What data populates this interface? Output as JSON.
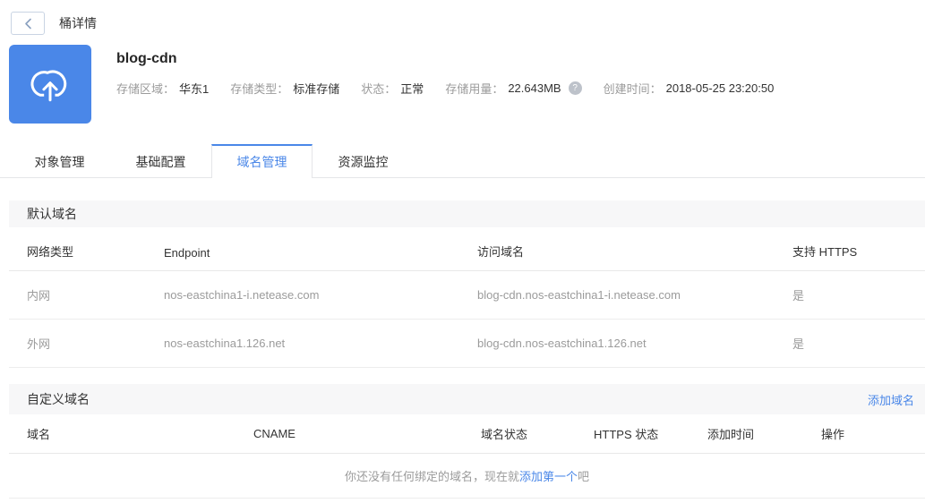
{
  "colors": {
    "accent": "#4a87e8",
    "text_dark": "#333333",
    "text_gray": "#9b9b9b",
    "section_bg": "#f7f7f8",
    "border": "#e8e8e8"
  },
  "topbar": {
    "title": "桶详情"
  },
  "bucket": {
    "name": "blog-cdn",
    "meta": [
      {
        "label": "存储区域：",
        "value": "华东1"
      },
      {
        "label": "存储类型：",
        "value": "标准存储"
      },
      {
        "label": "状态：",
        "value": "正常"
      },
      {
        "label": "存储用量：",
        "value": "22.643MB"
      },
      {
        "label": "创建时间：",
        "value": "2018-05-25 23:20:50"
      }
    ],
    "usage_help_glyph": "?"
  },
  "tabs": [
    {
      "label": "对象管理",
      "active": false
    },
    {
      "label": "基础配置",
      "active": false
    },
    {
      "label": "域名管理",
      "active": true
    },
    {
      "label": "资源监控",
      "active": false
    }
  ],
  "default_section": {
    "title": "默认域名",
    "headers": [
      "网络类型",
      "Endpoint",
      "访问域名",
      "支持 HTTPS"
    ],
    "rows": [
      [
        "内网",
        "nos-eastchina1-i.netease.com",
        "blog-cdn.nos-eastchina1-i.netease.com",
        "是"
      ],
      [
        "外网",
        "nos-eastchina1.126.net",
        "blog-cdn.nos-eastchina1.126.net",
        "是"
      ]
    ]
  },
  "custom_section": {
    "title": "自定义域名",
    "add_link": "添加域名",
    "headers": [
      "域名",
      "CNAME",
      "域名状态",
      "HTTPS 状态",
      "添加时间",
      "操作"
    ],
    "empty": {
      "prefix": "你还没有任何绑定的域名，现在就",
      "link": "添加第一个",
      "suffix": "吧"
    }
  }
}
